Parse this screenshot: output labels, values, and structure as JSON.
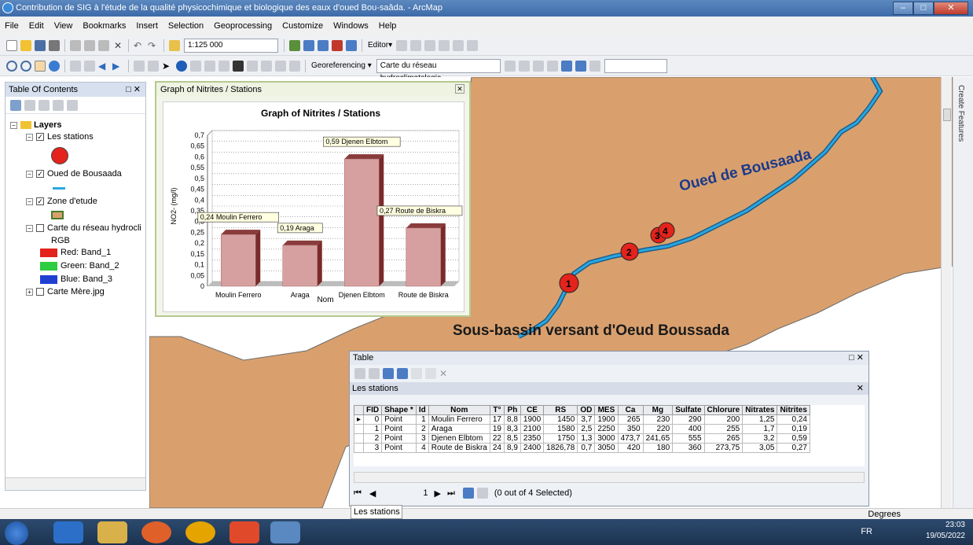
{
  "window": {
    "title": "Contribution de SIG à l'étude de la qualité physicochimique et biologique des eaux d'oued  Bou-saâda. - ArcMap"
  },
  "menu": [
    "File",
    "Edit",
    "View",
    "Bookmarks",
    "Insert",
    "Selection",
    "Geoprocessing",
    "Customize",
    "Windows",
    "Help"
  ],
  "toolbar": {
    "scale": "1:125 000",
    "editor": "Editor▾",
    "georef": "Georeferencing ▾",
    "layer_combo": "Carte du réseau hydroclimatologic"
  },
  "toc": {
    "title": "Table Of Contents",
    "items": [
      {
        "label": "Layers"
      },
      {
        "label": "Les stations"
      },
      {
        "label": "Oued de Bousaada"
      },
      {
        "label": "Zone d'etude"
      },
      {
        "label": "Carte du réseau hydrocli"
      },
      {
        "label": "RGB"
      },
      {
        "label": "Red:   Band_1"
      },
      {
        "label": "Green: Band_2"
      },
      {
        "label": "Blue:  Band_3"
      },
      {
        "label": "Carte Mère.jpg"
      }
    ]
  },
  "map": {
    "river_label": "Oued de Bousaada",
    "basin_label": "Sous-bassin versant d'Oeud Boussada",
    "stations": [
      "1",
      "2",
      "3",
      "4"
    ]
  },
  "graph_window": {
    "title": "Graph of Nitrites / Stations"
  },
  "chart_data": {
    "type": "bar",
    "title": "Graph of Nitrites / Stations",
    "categories": [
      "Moulin Ferrero",
      "Araga",
      "Djenen Elbtom",
      "Route de Biskra"
    ],
    "values": [
      0.24,
      0.19,
      0.59,
      0.27
    ],
    "data_labels": [
      "0,24 Moulin Ferrero",
      "0,19 Araga",
      "0,59 Djenen Elbtom",
      "0,27 Route de Biskra"
    ],
    "xlabel": "Nom",
    "ylabel": "NO2- (mg/l)",
    "ylim": [
      0,
      0.7
    ],
    "yticks": [
      "0",
      "0,05",
      "0,1",
      "0,15",
      "0,2",
      "0,25",
      "0,3",
      "0,35",
      "0,4",
      "0,45",
      "0,5",
      "0,55",
      "0,6",
      "0,65",
      "0,7"
    ],
    "grid": true
  },
  "table_window": {
    "title": "Table",
    "tab": "Les stations",
    "columns": [
      "FID",
      "Shape *",
      "Id",
      "Nom",
      "T°",
      "Ph",
      "CE",
      "RS",
      "OD",
      "MES",
      "Ca",
      "Mg",
      "Sulfate",
      "Chlorure",
      "Nitrates",
      "Nitrites"
    ],
    "rows": [
      [
        "0",
        "Point",
        "1",
        "Moulin Ferrero",
        "17",
        "8,8",
        "1900",
        "1450",
        "3,7",
        "1900",
        "265",
        "230",
        "290",
        "200",
        "1,25",
        "0,24"
      ],
      [
        "1",
        "Point",
        "2",
        "Araga",
        "19",
        "8,3",
        "2100",
        "1580",
        "2,5",
        "2250",
        "350",
        "220",
        "400",
        "255",
        "1,7",
        "0,19"
      ],
      [
        "2",
        "Point",
        "3",
        "Djenen Elbtom",
        "22",
        "8,5",
        "2350",
        "1750",
        "1,3",
        "3000",
        "473,7",
        "241,65",
        "555",
        "265",
        "3,2",
        "0,59"
      ],
      [
        "3",
        "Point",
        "4",
        "Route de Biskra",
        "24",
        "8,9",
        "2400",
        "1826,78",
        "0,7",
        "3050",
        "420",
        "180",
        "360",
        "273,75",
        "3,05",
        "0,27"
      ]
    ],
    "nav_page": "1",
    "selection": "(0 out of 4 Selected)",
    "bottom_tab": "Les stations"
  },
  "status": {
    "units": "Degrees"
  },
  "side_panel": {
    "label": "Create Features"
  },
  "taskbar": {
    "lang": "FR",
    "time": "23:03",
    "date": "19/05/2022"
  },
  "colors": {
    "map_land": "#d9a06e",
    "river": "#2aa7e0",
    "station": "#e3231c",
    "bar": "#d6a0a0",
    "bar_dark": "#7a2a2a"
  }
}
